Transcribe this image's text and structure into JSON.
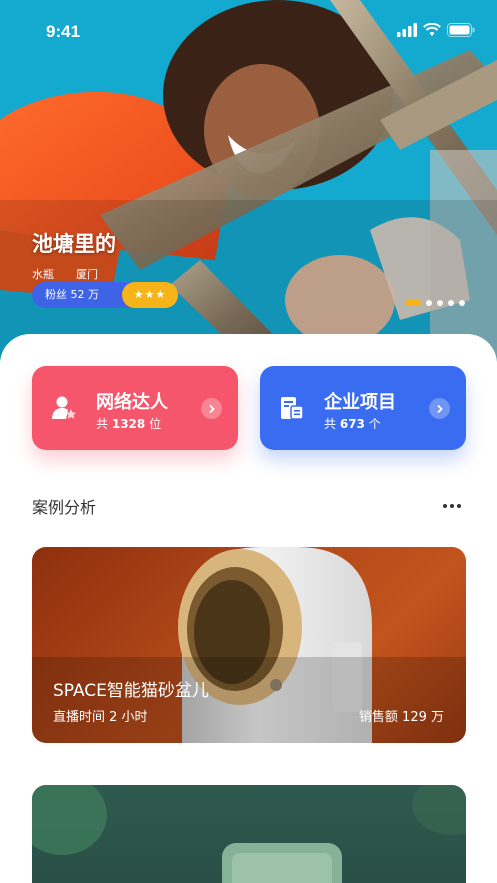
{
  "status_bar": {
    "time": "9:41"
  },
  "influencer": {
    "name": "池塘里的",
    "tags": [
      "水瓶",
      "厦门"
    ],
    "fans": "粉丝 52 万",
    "stars": "★★★"
  },
  "carousel": {
    "dot_count": 5,
    "active_index": 0
  },
  "cards": [
    {
      "title": "网络达人",
      "prefix": "共",
      "count": "1328",
      "suffix": "位",
      "color": "#f6566b"
    },
    {
      "title": "企业项目",
      "prefix": "共",
      "count": "673",
      "suffix": "个",
      "color": "#3a6cf2"
    }
  ],
  "section": {
    "title": "案例分析"
  },
  "cases": [
    {
      "title": "SPACE智能猫砂盆儿",
      "time": "直播时间 2 小时",
      "sales": "销售额 129 万"
    }
  ],
  "colors": {
    "accent_yellow": "#f6b419",
    "fans_blue": "#3e63e6"
  }
}
